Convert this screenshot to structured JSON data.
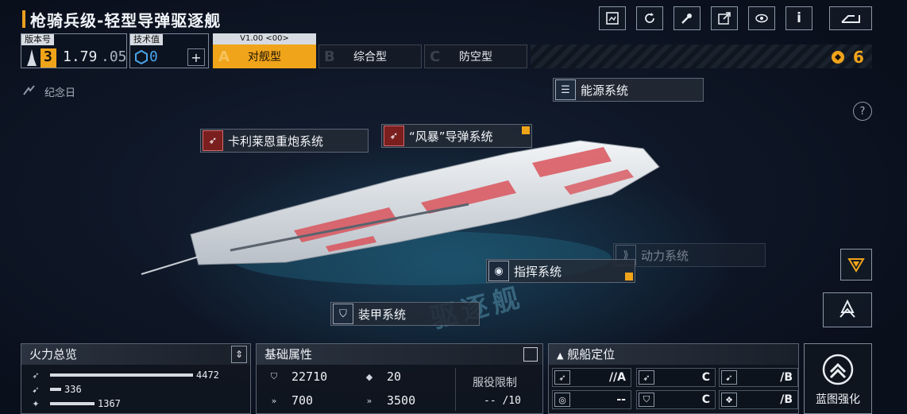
{
  "header": {
    "title": "枪骑兵级-轻型导弹驱逐舰",
    "toolbar_icons": [
      "blueprint-icon",
      "refresh-icon",
      "tools-icon",
      "share-icon",
      "view-icon",
      "info-icon",
      "back-icon"
    ],
    "info_glyph": "i"
  },
  "version": {
    "label": "版本号",
    "tier": "3",
    "number": "1.79",
    "sub": ".05"
  },
  "tech": {
    "label": "技术值",
    "value": "0",
    "plus": "+"
  },
  "tabs": {
    "version_label": "V1.00 <00>",
    "items": [
      {
        "letter": "A",
        "label": "对舰型"
      },
      {
        "letter": "B",
        "label": "综合型"
      },
      {
        "letter": "C",
        "label": "防空型"
      }
    ]
  },
  "currency": {
    "value": "6",
    "color": "#f0a41a"
  },
  "memorial": {
    "label": "纪念日"
  },
  "modules": {
    "energy": "能源系统",
    "cannon": "卡利莱恩重炮系统",
    "missile": "“风暴”导弹系统",
    "power": "动力系统",
    "command": "指挥系统",
    "armor": "装甲系统"
  },
  "help_glyph": "?",
  "ship_watermark": "驱逐舰",
  "firepower": {
    "title": "火力总览",
    "rows": [
      {
        "icon": "antiship-icon",
        "value": "4472",
        "fraction": 1.0
      },
      {
        "icon": "antiair-icon",
        "value": "336",
        "fraction": 0.08
      },
      {
        "icon": "siege-icon",
        "value": "1367",
        "fraction": 0.31
      }
    ]
  },
  "attributes": {
    "title": "基础属性",
    "hp": "22710",
    "armor": "20",
    "speed": "700",
    "range": "3500",
    "service_label": "服役限制",
    "service_value": "-- /10"
  },
  "positioning": {
    "title": "舰船定位",
    "cells": [
      {
        "icon": "antiship-icon",
        "value": "//A"
      },
      {
        "icon": "antiship-icon",
        "value": "C"
      },
      {
        "icon": "antiair-icon",
        "value": "/B"
      },
      {
        "icon": "target-icon",
        "value": "--"
      },
      {
        "icon": "armor-icon",
        "value": "C"
      },
      {
        "icon": "module-icon",
        "value": "/B"
      }
    ]
  },
  "upgrade": {
    "label": "蓝图强化"
  },
  "colors": {
    "accent": "#f0a41a",
    "hull_red": "#d9545c",
    "panel_bg": "#10161f"
  }
}
